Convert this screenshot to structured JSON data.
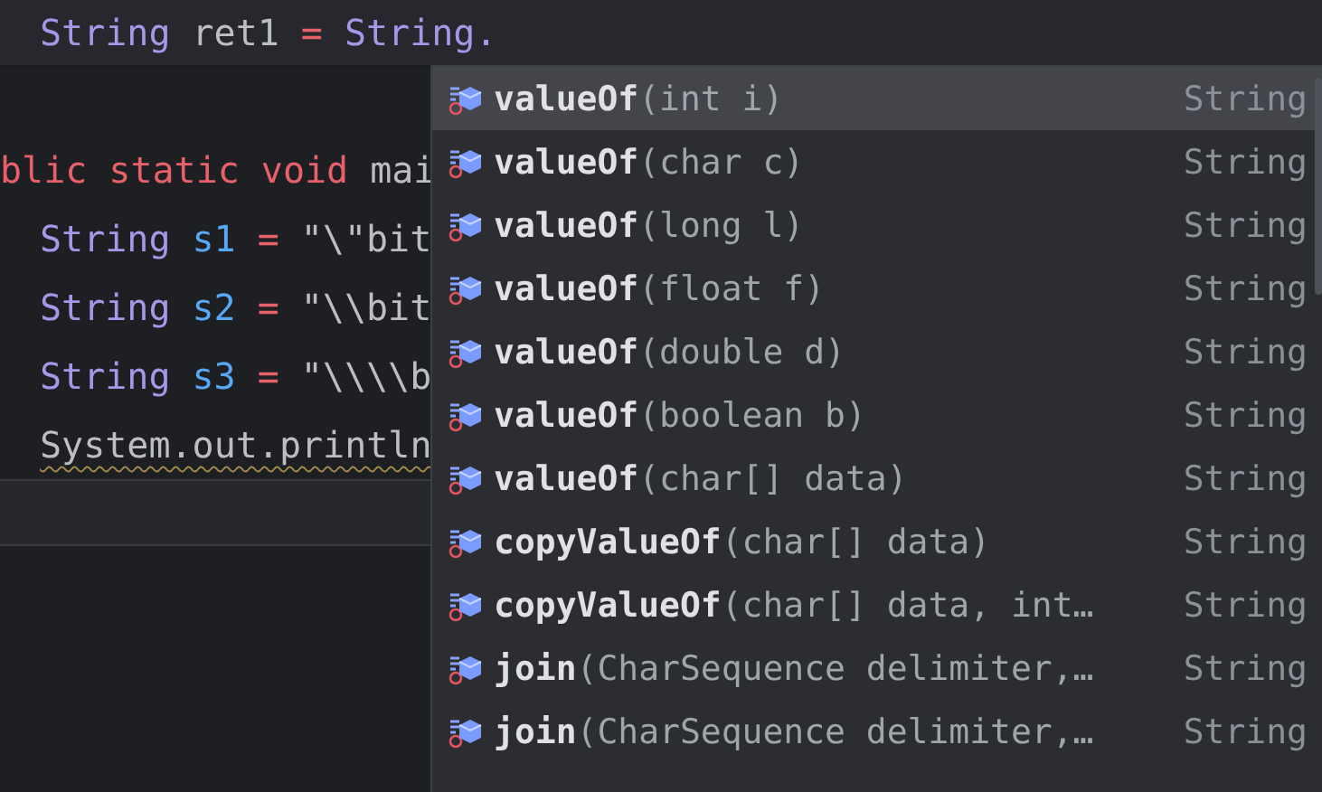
{
  "editor": {
    "lines": [
      {
        "indent": true,
        "current": true,
        "tokens": [
          {
            "text": "String",
            "kind": "type"
          },
          {
            "text": "ret1",
            "kind": "var"
          },
          {
            "text": "=",
            "kind": "op"
          },
          {
            "text": "String.",
            "kind": "type"
          }
        ]
      },
      {
        "indent": false,
        "current": false,
        "blank_line_before": true,
        "tokens": [
          {
            "text": "blic",
            "kind": "keyword"
          },
          {
            "text": "static",
            "kind": "keyword"
          },
          {
            "text": "void",
            "kind": "keyword"
          },
          {
            "text": "mai",
            "kind": "var"
          }
        ]
      },
      {
        "indent": true,
        "current": false,
        "tokens": [
          {
            "text": "String",
            "kind": "type"
          },
          {
            "text": "s1",
            "kind": "local"
          },
          {
            "text": "=",
            "kind": "op"
          },
          {
            "text": "\"\\\"bit",
            "kind": "string"
          }
        ]
      },
      {
        "indent": true,
        "current": false,
        "tokens": [
          {
            "text": "String",
            "kind": "type"
          },
          {
            "text": "s2",
            "kind": "local"
          },
          {
            "text": "=",
            "kind": "op"
          },
          {
            "text": "\"\\\\bit",
            "kind": "string"
          }
        ]
      },
      {
        "indent": true,
        "current": false,
        "tokens": [
          {
            "text": "String",
            "kind": "type"
          },
          {
            "text": "s3",
            "kind": "local"
          },
          {
            "text": "=",
            "kind": "op"
          },
          {
            "text": "\"\\\\\\\\b",
            "kind": "string"
          }
        ]
      },
      {
        "indent": true,
        "current": false,
        "tokens": [
          {
            "text": "System.out.println",
            "kind": "call",
            "warning": true
          }
        ]
      }
    ]
  },
  "completion": {
    "items": [
      {
        "name": "valueOf",
        "params": "(int i)",
        "type": "String",
        "selected": true
      },
      {
        "name": "valueOf",
        "params": "(char c)",
        "type": "String",
        "selected": false
      },
      {
        "name": "valueOf",
        "params": "(long l)",
        "type": "String",
        "selected": false
      },
      {
        "name": "valueOf",
        "params": "(float f)",
        "type": "String",
        "selected": false
      },
      {
        "name": "valueOf",
        "params": "(double d)",
        "type": "String",
        "selected": false
      },
      {
        "name": "valueOf",
        "params": "(boolean b)",
        "type": "String",
        "selected": false
      },
      {
        "name": "valueOf",
        "params": "(char[] data)",
        "type": "String",
        "selected": false
      },
      {
        "name": "copyValueOf",
        "params": "(char[] data)",
        "type": "String",
        "selected": false
      },
      {
        "name": "copyValueOf",
        "params": "(char[] data, int…",
        "type": "String",
        "selected": false
      },
      {
        "name": "join",
        "params": "(CharSequence delimiter,…",
        "type": "String",
        "selected": false
      },
      {
        "name": "join",
        "params": "(CharSequence delimiter,…",
        "type": "String",
        "selected": false
      }
    ]
  }
}
